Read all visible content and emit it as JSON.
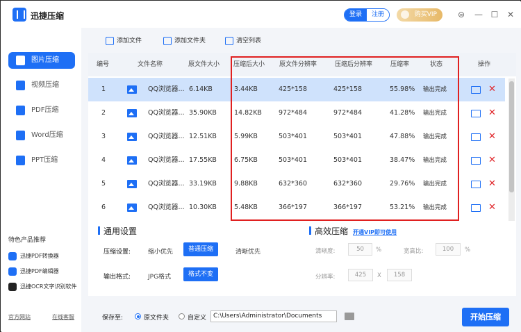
{
  "app": {
    "title": "迅捷压缩"
  },
  "header": {
    "login": "登录",
    "register": "注册",
    "vip": "购买VIP",
    "win_controls": [
      "⊜",
      "—",
      "☐",
      "✕"
    ]
  },
  "sidebar": {
    "items": [
      {
        "label": "图片压缩",
        "icon": "image-icon",
        "active": true
      },
      {
        "label": "视频压缩",
        "icon": "video-icon"
      },
      {
        "label": "PDF压缩",
        "icon": "pdf-icon"
      },
      {
        "label": "Word压缩",
        "icon": "word-icon"
      },
      {
        "label": "PPT压缩",
        "icon": "ppt-icon"
      }
    ],
    "featured_title": "特色产品推荐",
    "featured": [
      "迅捷PDF转换器",
      "迅捷PDF编辑器",
      "迅捷OCR文字识别软件"
    ],
    "links": {
      "website": "官方网站",
      "support": "在线客服"
    }
  },
  "toolbar": {
    "add_file": "添加文件",
    "add_folder": "添加文件夹",
    "clear_list": "清空列表"
  },
  "table": {
    "headers": [
      "编号",
      "文件名称",
      "原文件大小",
      "压缩后大小",
      "原文件分辨率",
      "压缩后分辨率",
      "压缩率",
      "状态",
      "操作"
    ],
    "rows": [
      [
        "1",
        "QQ浏览器...",
        "6.14KB",
        "3.44KB",
        "425*158",
        "425*158",
        "55.98%",
        "输出完成"
      ],
      [
        "2",
        "QQ浏览器...",
        "35.90KB",
        "14.82KB",
        "972*484",
        "972*484",
        "41.28%",
        "输出完成"
      ],
      [
        "3",
        "QQ浏览器...",
        "12.51KB",
        "5.99KB",
        "503*401",
        "503*401",
        "47.88%",
        "输出完成"
      ],
      [
        "4",
        "QQ浏览器...",
        "17.55KB",
        "6.75KB",
        "503*401",
        "503*401",
        "38.47%",
        "输出完成"
      ],
      [
        "5",
        "QQ浏览器...",
        "33.19KB",
        "9.88KB",
        "632*360",
        "632*360",
        "29.76%",
        "输出完成"
      ],
      [
        "6",
        "QQ浏览器...",
        "10.30KB",
        "5.48KB",
        "366*197",
        "366*197",
        "53.21%",
        "输出完成"
      ]
    ],
    "selected_row": 0
  },
  "general": {
    "title": "通用设置",
    "compress_label": "压缩设置:",
    "compress_options": [
      "缩小优先",
      "普通压缩",
      "清晰优先"
    ],
    "compress_selected": "普通压缩",
    "format_label": "输出格式:",
    "format_options": [
      "JPG格式",
      "格式不变"
    ],
    "format_selected": "格式不变"
  },
  "advanced": {
    "title": "高效压缩",
    "vip_link": "开通VIP即可使用",
    "clarity_label": "清晰度:",
    "clarity_value": "50",
    "clarity_unit": "%",
    "ratio_label": "宽高比:",
    "ratio_value": "100",
    "ratio_unit": "%",
    "resolution_label": "分辨率:",
    "res_w": "425",
    "res_x": "X",
    "res_h": "158"
  },
  "bottom": {
    "save_label": "保存至:",
    "opt_original": "原文件夹",
    "opt_custom": "自定义",
    "path": "C:\\Users\\Administrator\\Documents",
    "start": "开始压缩"
  }
}
